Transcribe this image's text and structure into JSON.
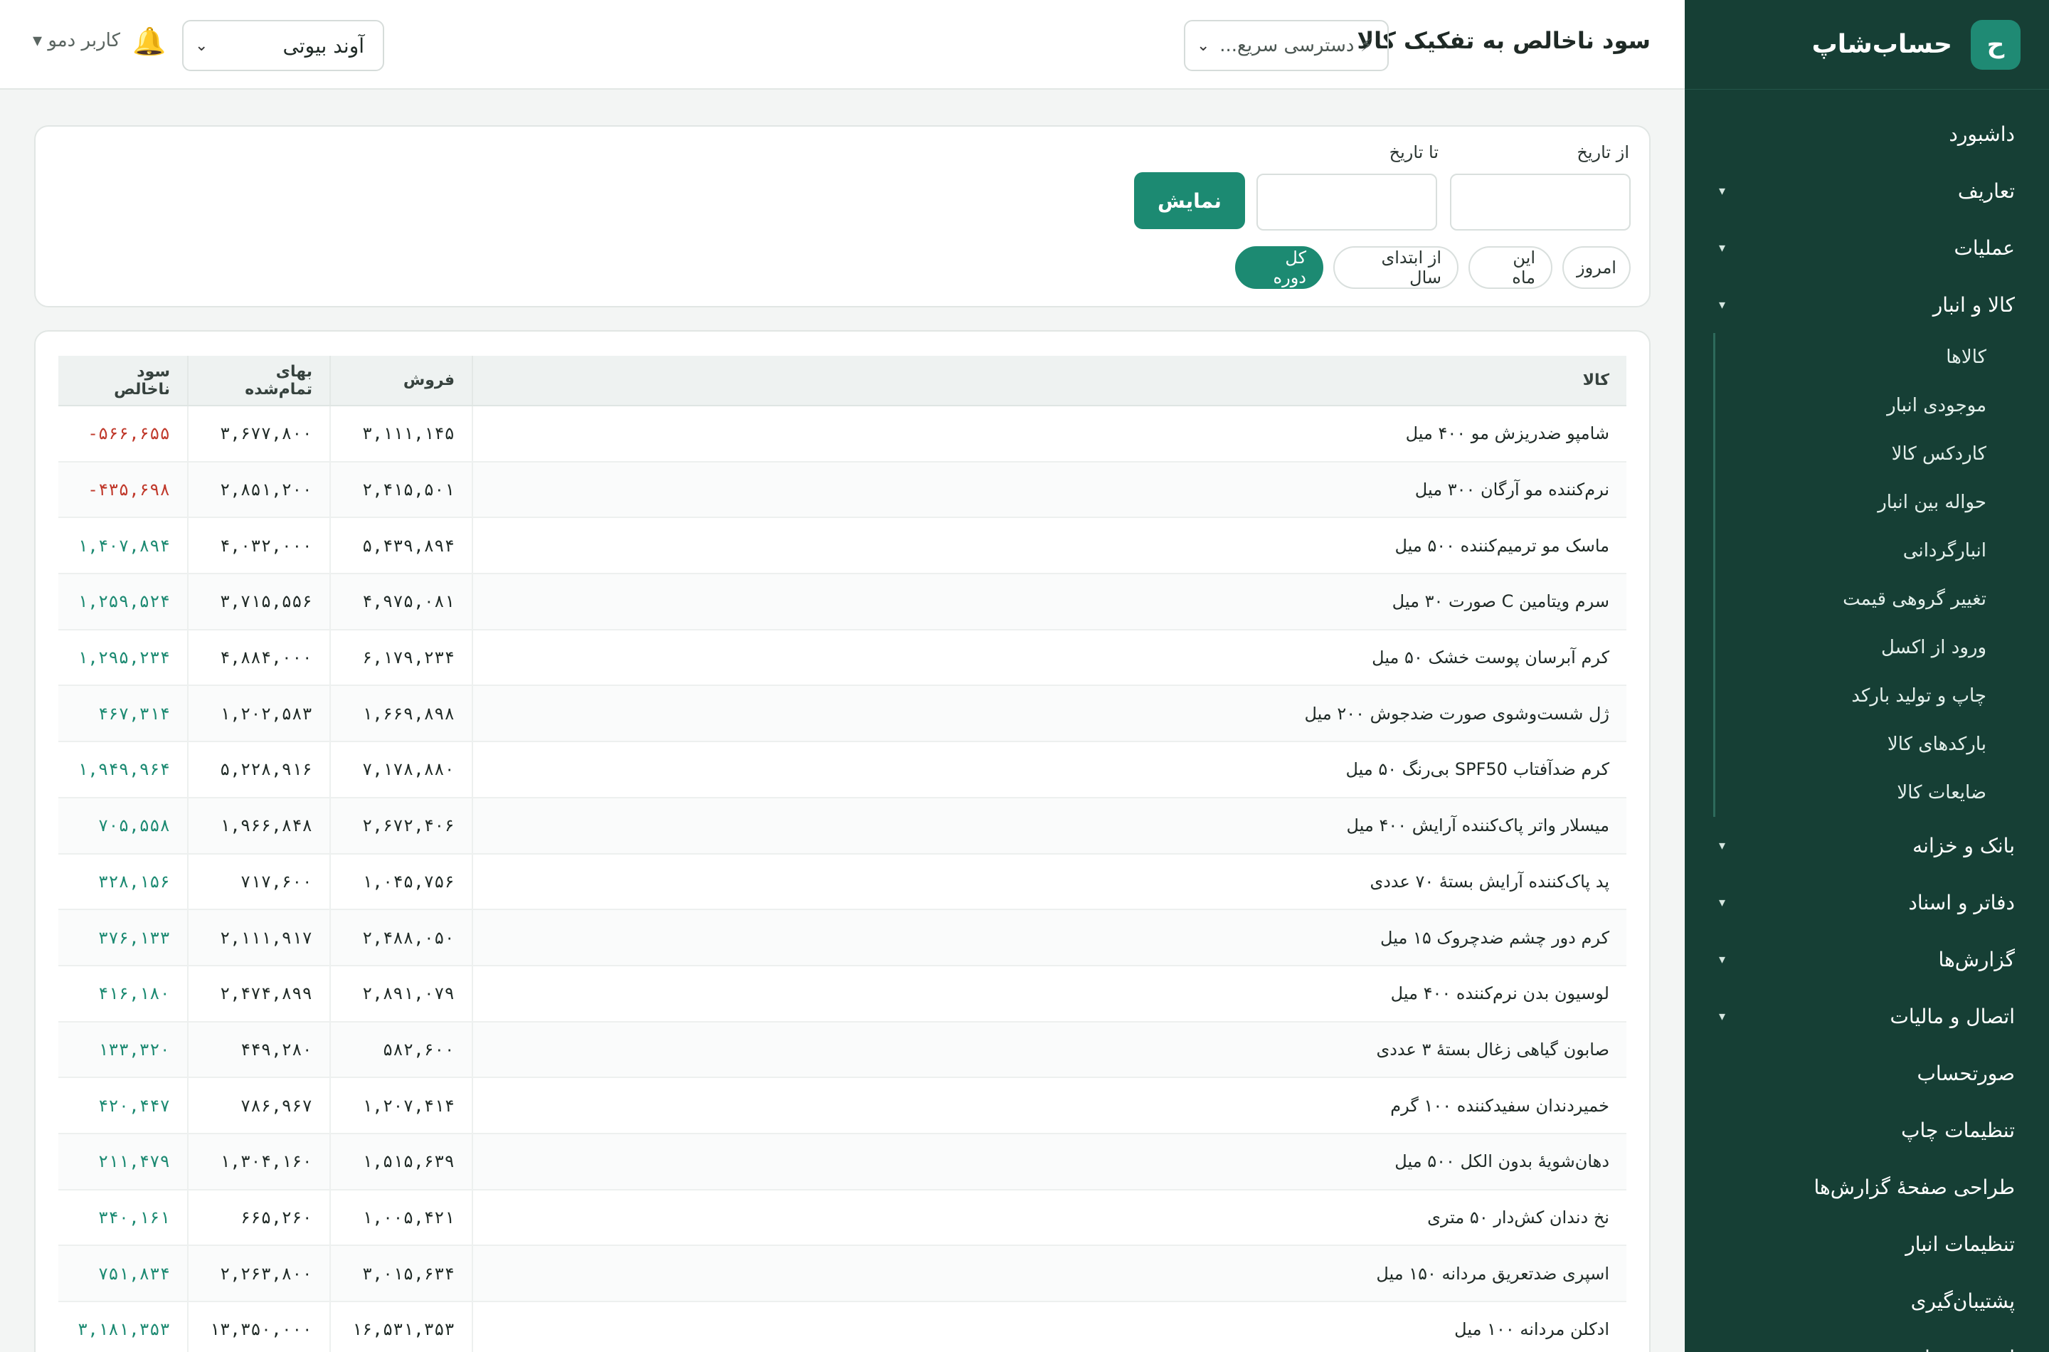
{
  "app": {
    "logo_letter": "ح",
    "name": "حساب‌شاپ"
  },
  "sidebar": {
    "items": [
      {
        "label": "داشبورد",
        "caret": ""
      },
      {
        "label": "تعاریف",
        "caret": "▾"
      },
      {
        "label": "عملیات",
        "caret": "▾"
      },
      {
        "label": "کالا و انبار",
        "caret": "▾"
      }
    ],
    "warehouse_sub": [
      "کالاها",
      "موجودی انبار",
      "کاردکس کالا",
      "حواله بین انبار",
      "انبارگردانی",
      "تغییر گروهی قیمت",
      "ورود از اکسل",
      "چاپ و تولید بارکد",
      "بارکدهای کالا",
      "ضایعات کالا"
    ],
    "items_after": [
      {
        "label": "بانک و خزانه",
        "caret": "▾"
      },
      {
        "label": "دفاتر و اسناد",
        "caret": "▾"
      },
      {
        "label": "گزارش‌ها",
        "caret": "▾"
      },
      {
        "label": "اتصال و مالیات",
        "caret": "▾"
      },
      {
        "label": "صورتحساب",
        "caret": ""
      },
      {
        "label": "تنظیمات چاپ",
        "caret": ""
      },
      {
        "label": "طراحی صفحهٔ گزارش‌ها",
        "caret": ""
      },
      {
        "label": "تنظیمات انبار",
        "caret": ""
      },
      {
        "label": "پشتیبان‌گیری",
        "caret": ""
      },
      {
        "label": "امنیت حساب",
        "caret": ""
      }
    ]
  },
  "header": {
    "title": "سود ناخالص به تفکیک کالا",
    "quick_access_placeholder": "⚡ دسترسی سریع...",
    "branch": "آوند بیوتی",
    "bell": "🔔",
    "user": "کاربر دمو ▾"
  },
  "filter": {
    "from_label": "از تاریخ",
    "to_label": "تا تاریخ",
    "show_button": "نمایش",
    "chips": {
      "today": "امروز",
      "this_month": "این ماه",
      "year_start": "از ابتدای سال",
      "all": "کل دوره"
    }
  },
  "table": {
    "headers": {
      "product": "کالا",
      "sales": "فروش",
      "cost": "بهای تمام‌شده",
      "gross": "سود ناخالص"
    },
    "rows": [
      [
        "شامپو ضدریزش مو ۴۰۰ میل",
        "۳,۱۱۱,۱۴۵",
        "۳,۶۷۷,۸۰۰",
        "۵۶۶,۶۵۵-",
        "neg"
      ],
      [
        "نرم‌کننده مو آرگان ۳۰۰ میل",
        "۲,۴۱۵,۵۰۱",
        "۲,۸۵۱,۲۰۰",
        "۴۳۵,۶۹۸-",
        "neg"
      ],
      [
        "ماسک مو ترمیم‌کننده ۵۰۰ میل",
        "۵,۴۳۹,۸۹۴",
        "۴,۰۳۲,۰۰۰",
        "۱,۴۰۷,۸۹۴",
        "pos"
      ],
      [
        "سرم ویتامین C صورت ۳۰ میل",
        "۴,۹۷۵,۰۸۱",
        "۳,۷۱۵,۵۵۶",
        "۱,۲۵۹,۵۲۴",
        "pos"
      ],
      [
        "کرم آبرسان پوست خشک ۵۰ میل",
        "۶,۱۷۹,۲۳۴",
        "۴,۸۸۴,۰۰۰",
        "۱,۲۹۵,۲۳۴",
        "pos"
      ],
      [
        "ژل شست‌وشوی صورت ضدجوش ۲۰۰ میل",
        "۱,۶۶۹,۸۹۸",
        "۱,۲۰۲,۵۸۳",
        "۴۶۷,۳۱۴",
        "pos"
      ],
      [
        "کرم ضدآفتاب SPF50 بی‌رنگ ۵۰ میل",
        "۷,۱۷۸,۸۸۰",
        "۵,۲۲۸,۹۱۶",
        "۱,۹۴۹,۹۶۴",
        "pos"
      ],
      [
        "میسلار واتر پاک‌کننده آرایش ۴۰۰ میل",
        "۲,۶۷۲,۴۰۶",
        "۱,۹۶۶,۸۴۸",
        "۷۰۵,۵۵۸",
        "pos"
      ],
      [
        "پد پاک‌کننده آرایش بستهٔ ۷۰ عددی",
        "۱,۰۴۵,۷۵۶",
        "۷۱۷,۶۰۰",
        "۳۲۸,۱۵۶",
        "pos"
      ],
      [
        "کرم دور چشم ضدچروک ۱۵ میل",
        "۲,۴۸۸,۰۵۰",
        "۲,۱۱۱,۹۱۷",
        "۳۷۶,۱۳۳",
        "pos"
      ],
      [
        "لوسیون بدن نرم‌کننده ۴۰۰ میل",
        "۲,۸۹۱,۰۷۹",
        "۲,۴۷۴,۸۹۹",
        "۴۱۶,۱۸۰",
        "pos"
      ],
      [
        "صابون گیاهی زغال بستهٔ ۳ عددی",
        "۵۸۲,۶۰۰",
        "۴۴۹,۲۸۰",
        "۱۳۳,۳۲۰",
        "pos"
      ],
      [
        "خمیردندان سفیدکننده ۱۰۰ گرم",
        "۱,۲۰۷,۴۱۴",
        "۷۸۶,۹۶۷",
        "۴۲۰,۴۴۷",
        "pos"
      ],
      [
        "دهان‌شویهٔ بدون الکل ۵۰۰ میل",
        "۱,۵۱۵,۶۳۹",
        "۱,۳۰۴,۱۶۰",
        "۲۱۱,۴۷۹",
        "pos"
      ],
      [
        "نخ دندان کش‌دار ۵۰ متری",
        "۱,۰۰۵,۴۲۱",
        "۶۶۵,۲۶۰",
        "۳۴۰,۱۶۱",
        "pos"
      ],
      [
        "اسپری ضدتعریق مردانه ۱۵۰ میل",
        "۳,۰۱۵,۶۳۴",
        "۲,۲۶۳,۸۰۰",
        "۷۵۱,۸۳۴",
        "pos"
      ],
      [
        "ادکلن مردانه ۱۰۰ میل",
        "۱۶,۵۳۱,۳۵۳",
        "۱۳,۳۵۰,۰۰۰",
        "۳,۱۸۱,۳۵۳",
        "pos"
      ]
    ]
  }
}
